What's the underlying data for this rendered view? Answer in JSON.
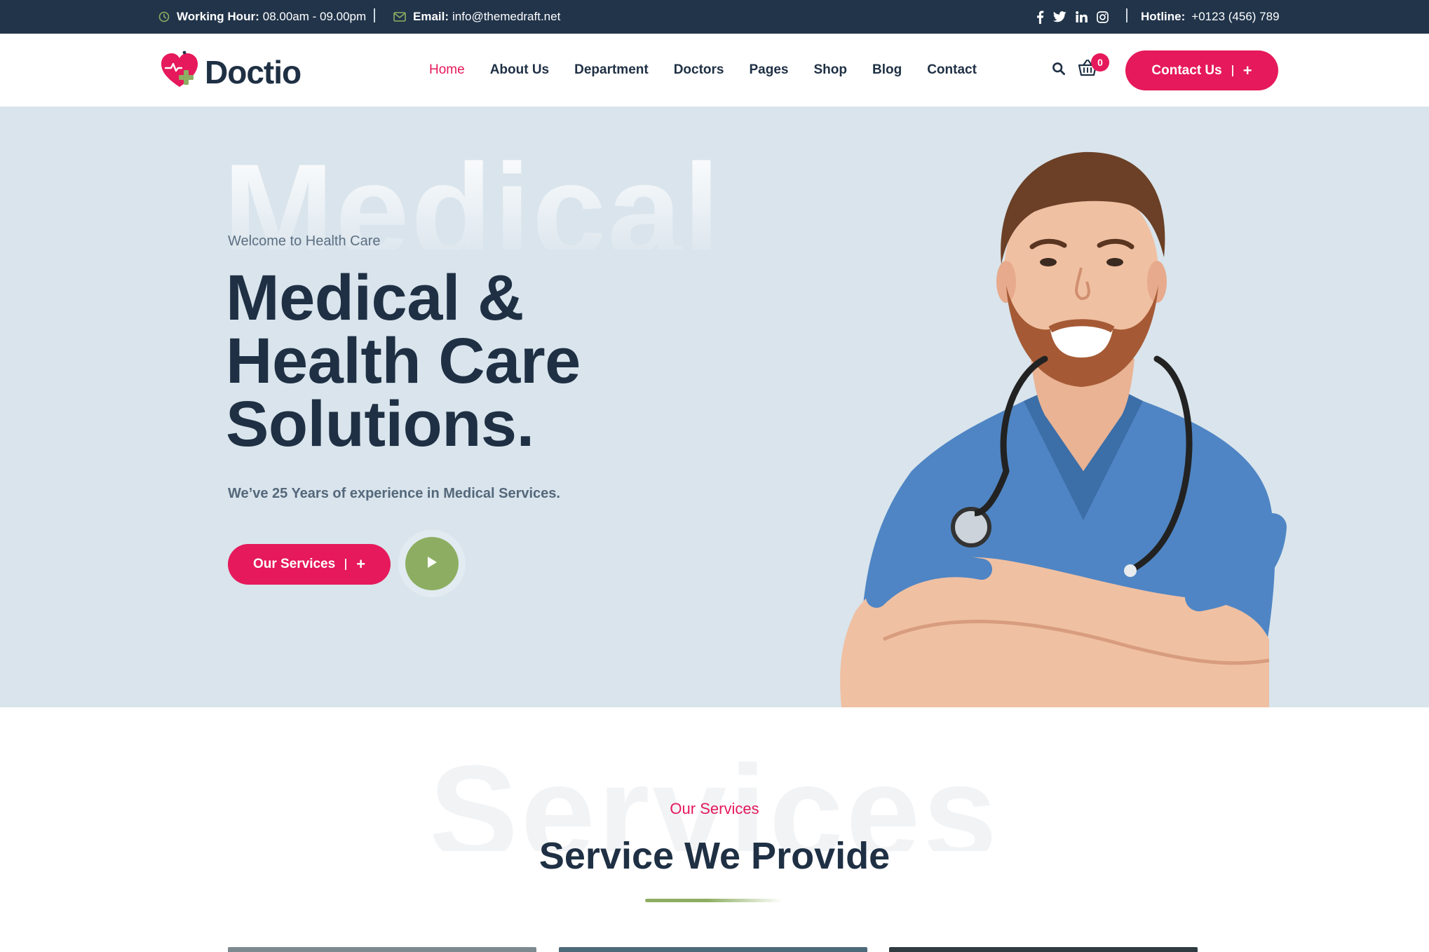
{
  "topbar": {
    "working_hour_label": "Working Hour:",
    "working_hour_value": "08.00am - 09.00pm",
    "email_label": "Email:",
    "email_value": "info@themedraft.net",
    "socials": [
      "facebook-icon",
      "twitter-icon",
      "linkedin-icon",
      "instagram-icon"
    ],
    "hotline_label": "Hotline:",
    "hotline_value": "+0123 (456) 789"
  },
  "header": {
    "logo_text": "Doctio",
    "nav": [
      {
        "label": "Home",
        "active": true
      },
      {
        "label": "About Us"
      },
      {
        "label": "Department"
      },
      {
        "label": "Doctors"
      },
      {
        "label": "Pages"
      },
      {
        "label": "Shop"
      },
      {
        "label": "Blog"
      },
      {
        "label": "Contact"
      }
    ],
    "cart_count": "0",
    "contact_button": "Contact Us",
    "contact_button_icon": "+"
  },
  "hero": {
    "watermark": "Medical",
    "eyebrow": "Welcome to Health Care",
    "title_lines": [
      "Medical &",
      "Health Care",
      "Solutions."
    ],
    "subtitle": "We’ve 25 Years of experience in Medical Services.",
    "primary_button": "Our Services",
    "primary_button_icon": "+",
    "play_icon": "play-icon"
  },
  "services": {
    "watermark": "Services",
    "eyebrow": "Our Services",
    "title": "Service We Provide"
  },
  "colors": {
    "accent": "#e5195b",
    "secondary": "#8dae62",
    "dark": "#21344a",
    "hero_bg": "#d9e4ec",
    "heading": "#1f3044"
  }
}
